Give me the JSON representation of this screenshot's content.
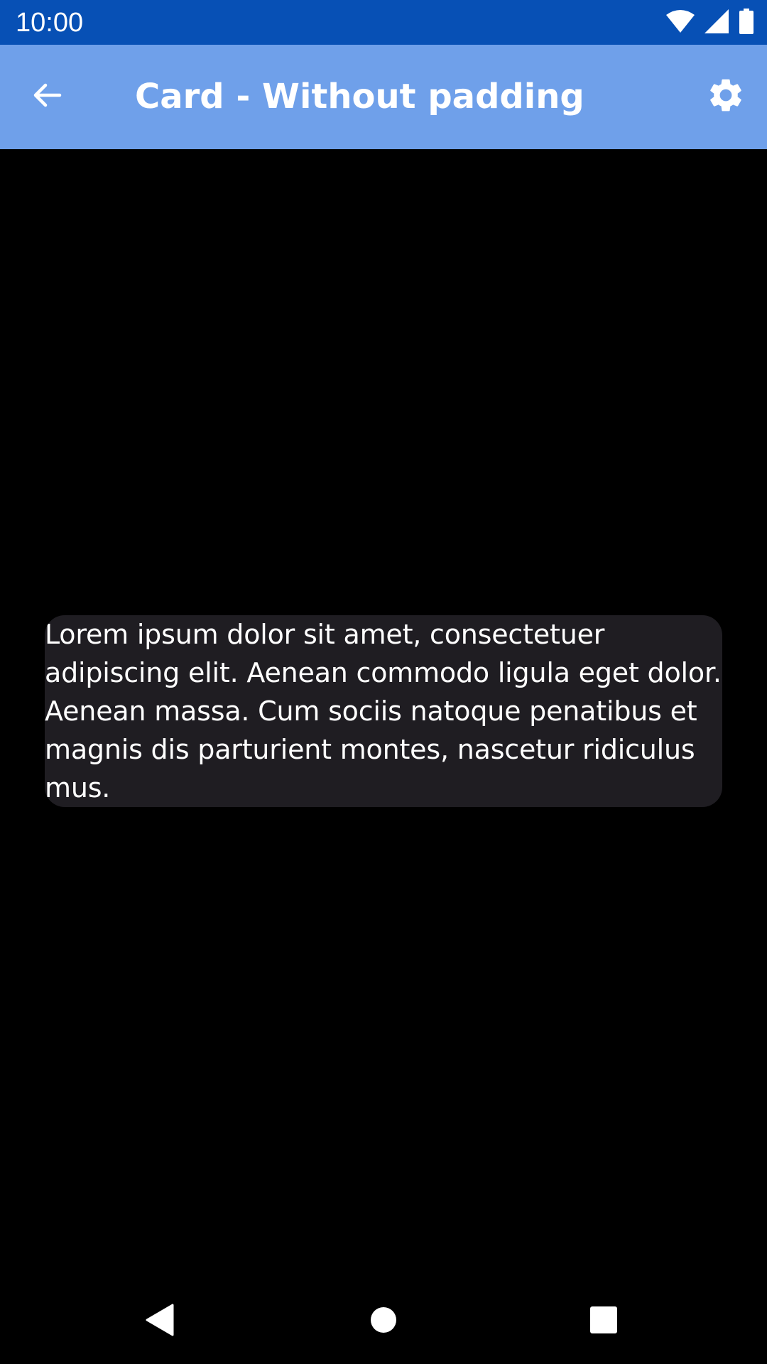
{
  "status_bar": {
    "time": "10:00",
    "icons": [
      "wifi-icon",
      "cellular-signal-icon",
      "battery-icon"
    ]
  },
  "app_bar": {
    "title": "Card - Without padding",
    "back_icon": "arrow-back-icon",
    "settings_icon": "gear-icon"
  },
  "card": {
    "text": "Lorem ipsum dolor sit amet, consectetuer adipiscing elit. Aenean commodo ligula eget dolor. Aenean massa. Cum sociis natoque penatibus et magnis dis parturient montes, nascetur ridiculus mus."
  },
  "nav_bar": {
    "icons": [
      "nav-back-icon",
      "nav-home-icon",
      "nav-recents-icon"
    ]
  },
  "colors": {
    "status_bar": "#0750b5",
    "app_bar": "#6fa0ea",
    "background": "#000000",
    "card": "#1f1d22",
    "text": "#ffffff"
  }
}
